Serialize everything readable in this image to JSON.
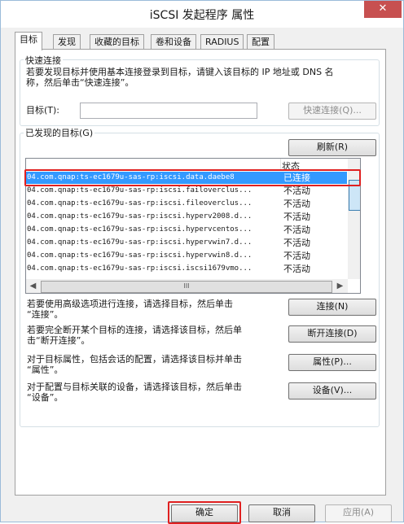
{
  "window": {
    "title": "iSCSI 发起程序 属性",
    "close": "✕"
  },
  "tabs": [
    {
      "label": "目标"
    },
    {
      "label": "发现"
    },
    {
      "label": "收藏的目标"
    },
    {
      "label": "卷和设备"
    },
    {
      "label": "RADIUS"
    },
    {
      "label": "配置"
    }
  ],
  "quick_connect": {
    "group_label": "快速连接",
    "desc_line1": "若要发现目标并使用基本连接登录到目标，请键入该目标的 IP 地址或 DNS 名",
    "desc_line2": "称，然后单击“快速连接”。",
    "target_label": "目标(T):",
    "target_value": "",
    "button": "快速连接(Q)..."
  },
  "discovered": {
    "group_label": "已发现的目标(G)",
    "refresh_button": "刷新(R)",
    "col_status": "状态",
    "rows": [
      {
        "name": "04.com.qnap:ts-ec1679u-sas-rp:iscsi.data.daebe8",
        "status": "已连接"
      },
      {
        "name": "04.com.qnap:ts-ec1679u-sas-rp:iscsi.failoverclus...",
        "status": "不活动"
      },
      {
        "name": "04.com.qnap:ts-ec1679u-sas-rp:iscsi.fileoverclus...",
        "status": "不活动"
      },
      {
        "name": "04.com.qnap:ts-ec1679u-sas-rp:iscsi.hyperv2008.d...",
        "status": "不活动"
      },
      {
        "name": "04.com.qnap:ts-ec1679u-sas-rp:iscsi.hypervcentos...",
        "status": "不活动"
      },
      {
        "name": "04.com.qnap:ts-ec1679u-sas-rp:iscsi.hypervwin7.d...",
        "status": "不活动"
      },
      {
        "name": "04.com.qnap:ts-ec1679u-sas-rp:iscsi.hypervwin8.d...",
        "status": "不活动"
      },
      {
        "name": "04.com.qnap:ts-ec1679u-sas-rp:iscsi.iscsi1679vmo...",
        "status": "不活动"
      }
    ],
    "hscroll_grip": "III"
  },
  "actions": [
    {
      "line1": "若要使用高级选项进行连接，请选择目标，然后单击",
      "line2": "“连接”。",
      "button": "连接(N)"
    },
    {
      "line1": "若要完全断开某个目标的连接，请选择该目标，然后单",
      "line2": "击“断开连接”。",
      "button": "断开连接(D)"
    },
    {
      "line1": "对于目标属性，包括会话的配置，请选择该目标并单击",
      "line2": "“属性”。",
      "button": "属性(P)..."
    },
    {
      "line1": "对于配置与目标关联的设备，请选择该目标，然后单击",
      "line2": "“设备”。",
      "button": "设备(V)..."
    }
  ],
  "footer": {
    "ok": "确定",
    "cancel": "取消",
    "apply": "应用(A)"
  },
  "colors": {
    "selection": "#3399ff",
    "highlight": "#e02020",
    "close": "#c75050"
  }
}
